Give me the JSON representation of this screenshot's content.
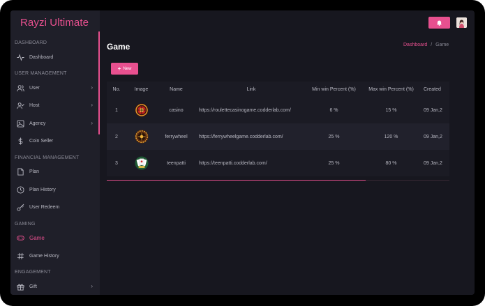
{
  "app": {
    "title": "Rayzi Ultimate"
  },
  "sidebar": {
    "sections": [
      {
        "label": "DASHBOARD"
      },
      {
        "label": "USER MANAGEMENT"
      },
      {
        "label": "FINANCIAL MANAGEMENT"
      },
      {
        "label": "GAMING"
      },
      {
        "label": "ENGAGEMENT"
      }
    ],
    "items": [
      {
        "label": "Dashboard",
        "icon": "activity-icon"
      },
      {
        "label": "User",
        "icon": "users-icon",
        "chevron": "›"
      },
      {
        "label": "Host",
        "icon": "user-check-icon",
        "chevron": "›"
      },
      {
        "label": "Agency",
        "icon": "image-icon",
        "chevron": "›"
      },
      {
        "label": "Coin Seller",
        "icon": "dollar-icon"
      },
      {
        "label": "Plan",
        "icon": "file-icon"
      },
      {
        "label": "Plan History",
        "icon": "clock-icon"
      },
      {
        "label": "User Redeem",
        "icon": "key-icon"
      },
      {
        "label": "Game",
        "icon": "gamepad-icon",
        "active": true
      },
      {
        "label": "Game History",
        "icon": "hash-icon"
      },
      {
        "label": "Gift",
        "icon": "gift-icon",
        "chevron": "›"
      }
    ]
  },
  "header": {
    "bell_icon": "bell-icon",
    "avatar": "user-avatar"
  },
  "page": {
    "title": "Game",
    "breadcrumb": {
      "home": "Dashboard",
      "separator": "/",
      "current": "Game"
    },
    "new_button": {
      "icon": "+",
      "label": "New"
    }
  },
  "table": {
    "headers": [
      "No.",
      "Image",
      "Name",
      "Link",
      "Min win Percent (%)",
      "Max win Percent (%)",
      "Created"
    ],
    "rows": [
      {
        "no": "1",
        "image": "roulette-game-icon",
        "name": "casino",
        "link": "https://roulettecasinogame.codderlab.com/",
        "min": "6 %",
        "max": "15 %",
        "created": "09 Jan,2"
      },
      {
        "no": "2",
        "image": "ferrywheel-game-icon",
        "name": "ferrywheel",
        "link": "https://ferrywheelgame.codderlab.com/",
        "min": "25 %",
        "max": "120 %",
        "created": "09 Jan,2"
      },
      {
        "no": "3",
        "image": "teenpatti-game-icon",
        "name": "teenpatti",
        "link": "https://teenpatti.codderlab.com/",
        "min": "25 %",
        "max": "80 %",
        "created": "09 Jan,2"
      }
    ]
  },
  "colors": {
    "accent": "#e8508f",
    "background": "#17171f",
    "sidebar": "#1f1f29"
  }
}
